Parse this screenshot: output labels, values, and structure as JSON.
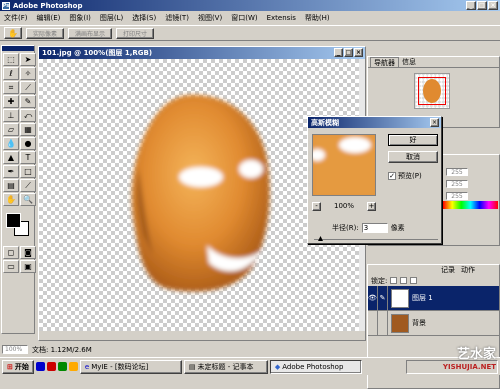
{
  "app": {
    "title": "Adobe Photoshop"
  },
  "menu": [
    "文件(F)",
    "编辑(E)",
    "图象(I)",
    "图层(L)",
    "选择(S)",
    "滤镜(T)",
    "视图(V)",
    "窗口(W)",
    "Extensis",
    "帮助(H)"
  ],
  "options_bar": {
    "actual_pixels": "实际像素",
    "fit_screen": "满画布显示",
    "print_size": "打印尺寸"
  },
  "document": {
    "title": "101.jpg @ 100%(图层 1,RGB)"
  },
  "navigator": {
    "tab_navigator": "导航器",
    "tab_info": "信息"
  },
  "color_panel": {
    "values": [
      "255",
      "255",
      "255"
    ]
  },
  "layers": {
    "tabs": [
      "记录",
      "动作"
    ],
    "lock_label": "锁定:",
    "items": [
      {
        "name": "图层 1",
        "selected": true
      },
      {
        "name": "背景",
        "selected": false
      }
    ]
  },
  "dialog": {
    "title": "高斯模糊",
    "ok": "好",
    "cancel": "取消",
    "preview_label": "预览(P)",
    "preview_checked": true,
    "zoom": "100%",
    "zoom_out": "-",
    "zoom_in": "+",
    "radius_label": "半径(R):",
    "radius_value": "3",
    "radius_unit": "像素"
  },
  "status": {
    "zoom": "100%",
    "doc_info": "文档: 1.12M/2.6M"
  },
  "taskbar": {
    "start": "开始",
    "tasks": [
      "MyIE - [数码论坛]",
      "未定标题 - 记事本",
      "Adobe Photoshop"
    ],
    "active_task_index": 2
  },
  "watermark": {
    "main": "艺水家",
    "sub": "YISHUJIA.NET"
  },
  "colors": {
    "accent": "#0a246a",
    "face": "#e0903a"
  }
}
